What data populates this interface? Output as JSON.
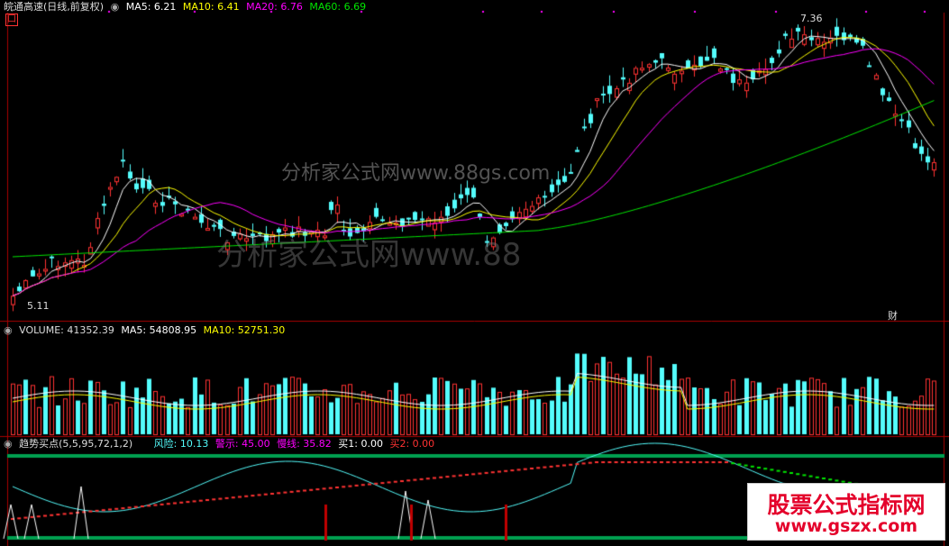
{
  "colors": {
    "up": "#ff3232",
    "down": "#54fcfc",
    "ma5": "#ffffff",
    "ma10": "#ffff00",
    "ma20": "#ff00ff",
    "ma60": "#00e600",
    "separator": "#aa0000",
    "green_band": "#00a050"
  },
  "main_panel": {
    "title": "皖通高速(日线,前复权)",
    "ma5": "MA5: 6.21",
    "ma10": "MA10: 6.41",
    "ma20": "MA20: 6.76",
    "ma60": "MA60: 6.69",
    "high_label": "7.36",
    "low_label": "5.11",
    "cai_label": "财",
    "box_label": "口"
  },
  "volume_panel": {
    "volume": "VOLUME: 41352.39",
    "ma5": "MA5: 54808.95",
    "ma10": "MA10: 52751.30"
  },
  "indicator_panel": {
    "name": "趋势买点(5,5,95,72,1,2)",
    "risk": "风险: 10.13",
    "warn": "警示: 45.00",
    "slow": "慢线: 35.82",
    "buy1": "买1: 0.00",
    "buy2": "买2: 0.00"
  },
  "watermark": {
    "line1": "分析家公式网www.88gs.com",
    "line2": "分析家公式网www.88"
  },
  "brand": {
    "title": "股票公式指标网",
    "url": "www.gszx.com"
  }
}
